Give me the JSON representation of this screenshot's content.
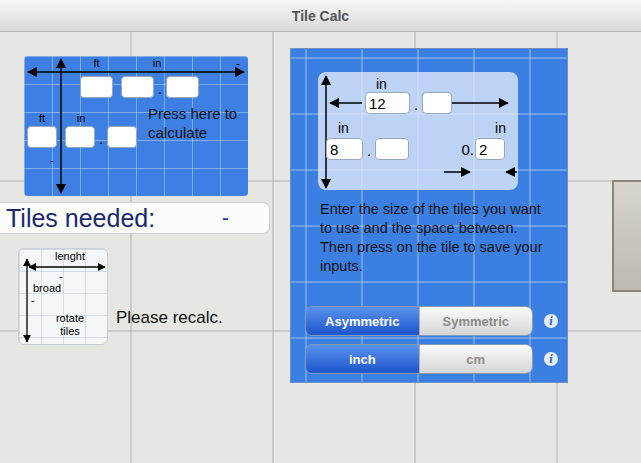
{
  "window": {
    "title": "Tile Calc"
  },
  "area_panel": {
    "top_labels": [
      "ft",
      "in"
    ],
    "top_fields": [
      "",
      "",
      ""
    ],
    "bottom_labels": [
      "ft",
      "in"
    ],
    "bottom_fields": [
      "",
      "",
      ""
    ],
    "separator": ".",
    "marks": [
      "-",
      "-"
    ],
    "hint": "Press here to calculate"
  },
  "result": {
    "label": "Tiles needed:",
    "value": "-"
  },
  "rotate": {
    "length_label": "lenght",
    "broad_label": "broad",
    "length_value": "-",
    "broad_value": "-",
    "button": "rotate tiles",
    "message": "Please recalc."
  },
  "tile_panel": {
    "width_unit": "in",
    "height_unit": "in",
    "gap_unit": "in",
    "width_fields": [
      "12",
      ""
    ],
    "height_fields": [
      "8",
      ""
    ],
    "separator": ".",
    "gap_prefix": "0.",
    "gap": "2",
    "instructions": [
      "Enter the size of the tiles you want to use and the space between.",
      "Then press on the tile to save your inputs."
    ]
  },
  "layout_modes": [
    {
      "label": "Asymmetric",
      "selected": true
    },
    {
      "label": "Symmetric",
      "selected": false
    }
  ],
  "units": [
    {
      "label": "inch",
      "selected": true
    },
    {
      "label": "cm",
      "selected": false
    }
  ],
  "info_icon": "i"
}
